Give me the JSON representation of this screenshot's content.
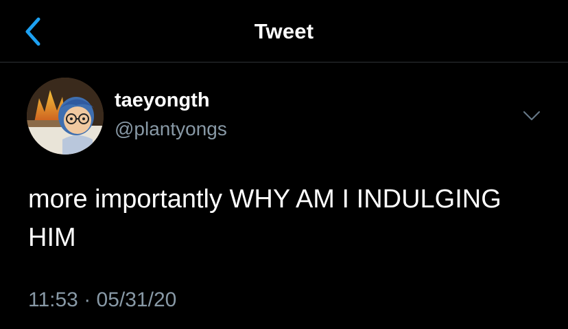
{
  "nav": {
    "title": "Tweet",
    "back_icon": "chevron-left-icon"
  },
  "author": {
    "display_name": "taeyongth",
    "handle": "@plantyongs",
    "avatar": "animal-crossing-villager-avatar"
  },
  "tweet": {
    "text": "more importantly WHY AM I INDULGING HIM",
    "time": "11:53",
    "separator": "·",
    "date": "05/31/20",
    "menu_icon": "chevron-down-icon"
  },
  "colors": {
    "background": "#000000",
    "accent": "#1da1f2",
    "secondary_text": "#8899a6",
    "divider": "#2f3336"
  }
}
